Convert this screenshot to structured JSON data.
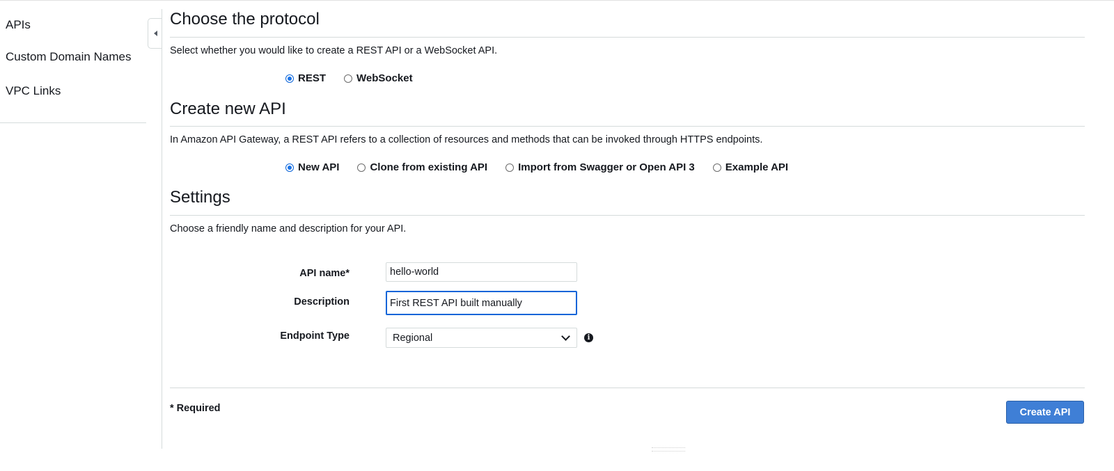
{
  "sidebar": {
    "items": [
      {
        "label": "APIs"
      },
      {
        "label": "Custom Domain Names"
      },
      {
        "label": "VPC Links"
      }
    ]
  },
  "protocol": {
    "title": "Choose the protocol",
    "description": "Select whether you would like to create a REST API or a WebSocket API.",
    "options": [
      {
        "label": "REST",
        "checked": true
      },
      {
        "label": "WebSocket",
        "checked": false
      }
    ]
  },
  "create_new": {
    "title": "Create new API",
    "description": "In Amazon API Gateway, a REST API refers to a collection of resources and methods that can be invoked through HTTPS endpoints.",
    "options": [
      {
        "label": "New API",
        "checked": true
      },
      {
        "label": "Clone from existing API",
        "checked": false
      },
      {
        "label": "Import from Swagger or Open API 3",
        "checked": false
      },
      {
        "label": "Example API",
        "checked": false
      }
    ]
  },
  "settings": {
    "title": "Settings",
    "description": "Choose a friendly name and description for your API.",
    "api_name_label": "API name*",
    "api_name_value": "hello-world",
    "description_label": "Description",
    "description_value": "First REST API built manually",
    "endpoint_label": "Endpoint Type",
    "endpoint_value": "Regional"
  },
  "footer": {
    "required_note": "* Required",
    "create_button": "Create API"
  },
  "colors": {
    "primary_button": "#3f7fd6",
    "radio_selected": "#1a73e8",
    "focus_border": "#0a64d8"
  }
}
